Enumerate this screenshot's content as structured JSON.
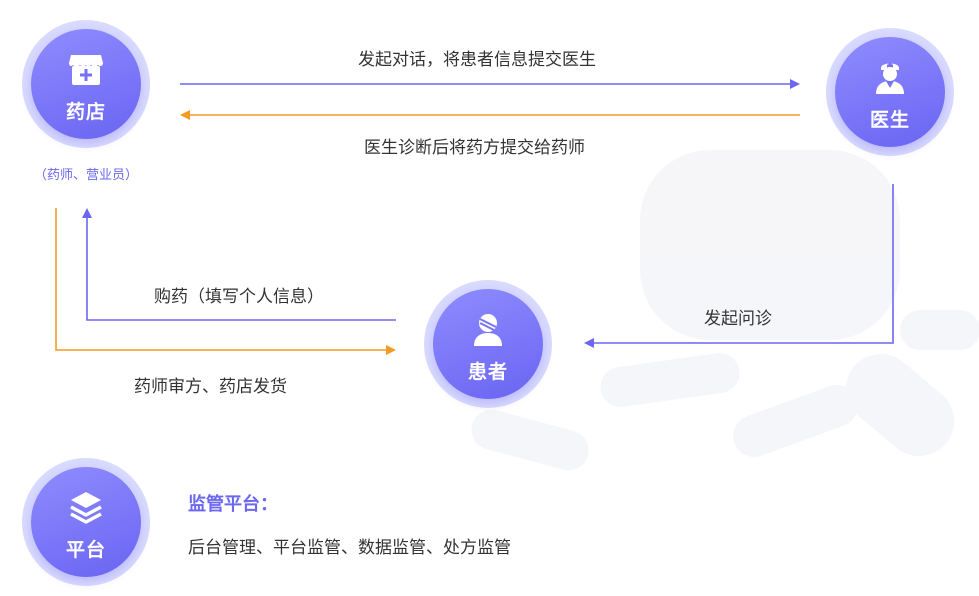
{
  "nodes": {
    "pharmacy": {
      "label": "药店",
      "note": "（药师、营业员）",
      "icon": "pharmacy-store-icon"
    },
    "doctor": {
      "label": "医生",
      "icon": "doctor-icon"
    },
    "patient": {
      "label": "患者",
      "icon": "patient-icon"
    },
    "platform": {
      "label": "平台",
      "icon": "layers-icon"
    }
  },
  "flows": [
    {
      "from": "pharmacy",
      "to": "doctor",
      "text": "发起对话，将患者信息提交医生",
      "color": "#6b67f0"
    },
    {
      "from": "doctor",
      "to": "pharmacy",
      "text": "医生诊断后将药方提交给药师",
      "color": "#f59a23"
    },
    {
      "from": "patient",
      "to": "pharmacy",
      "text": "购药（填写个人信息）",
      "color": "#6b67f0"
    },
    {
      "from": "doctor",
      "to": "patient",
      "text": "发起问诊",
      "color": "#6b67f0"
    },
    {
      "from": "pharmacy",
      "to": "patient",
      "text": "药师审方、药店发货",
      "color": "#f59a23"
    }
  ],
  "platform": {
    "title": "监管平台：",
    "description": "后台管理、平台监管、数据监管、处方监管"
  },
  "colors": {
    "accent": "#6b67f0",
    "orange": "#f59a23",
    "text": "#333333"
  }
}
